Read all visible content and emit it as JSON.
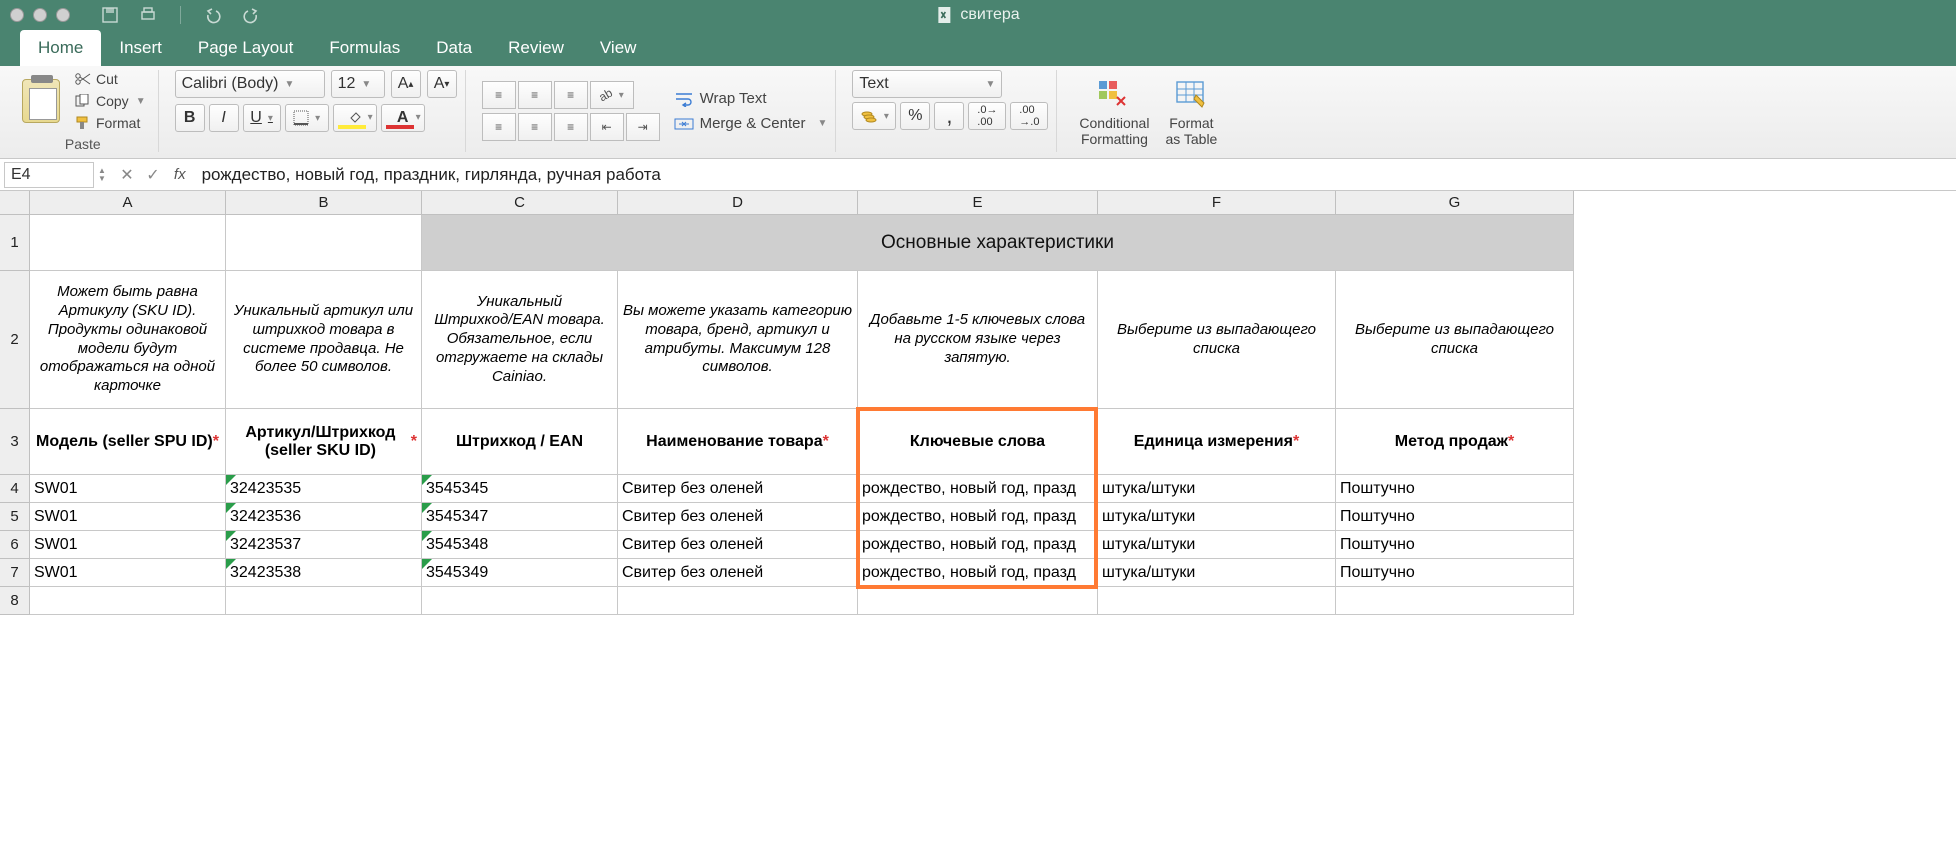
{
  "titlebar": {
    "doc_name": "свитера"
  },
  "tabs": {
    "home": "Home",
    "insert": "Insert",
    "page_layout": "Page Layout",
    "formulas": "Formulas",
    "data": "Data",
    "review": "Review",
    "view": "View"
  },
  "clipboard": {
    "paste": "Paste",
    "cut": "Cut",
    "copy": "Copy",
    "format": "Format"
  },
  "font": {
    "name": "Calibri (Body)",
    "size": "12",
    "bold": "B",
    "italic": "I",
    "underline": "U"
  },
  "align": {
    "wrap": "Wrap Text",
    "merge": "Merge & Center"
  },
  "number": {
    "format": "Text",
    "percent": "%",
    "comma": ",",
    "inc": ".00",
    "dec": ".0"
  },
  "cond": {
    "label1": "Conditional",
    "label2": "Formatting"
  },
  "fmt_table": {
    "label1": "Format",
    "label2": "as Table"
  },
  "formula_bar": {
    "cell_ref": "E4",
    "fx": "fx",
    "value": "рождество, новый год, праздник, гирлянда, ручная работа"
  },
  "columns": [
    "A",
    "B",
    "C",
    "D",
    "E",
    "F",
    "G"
  ],
  "row1_title": "Основные характеристики",
  "row2_desc": {
    "A": "Может быть равна Артикулу (SKU ID). Продукты одинаковой модели будут отображаться на одной карточке",
    "B": "Уникальный артикул или штрихкод товара в системе продавца. Не более 50 символов.",
    "C": "Уникальный Штрихкод/EAN товара. Обязательное, если отгружаете на склады Cainiao.",
    "D": "Вы можете указать категорию товара, бренд, артикул и атрибуты. Максимум 128 символов.",
    "E": "Добавьте 1-5 ключевых слова на русском языке через запятую.",
    "F": "Выберите из выпадающего списка",
    "G": "Выберите из выпадающего списка"
  },
  "row3_labels": {
    "A": "Модель (seller SPU ID)",
    "B": "Артикул/Штрихкод (seller SKU ID)",
    "C": "Штрихкод  / EAN",
    "D": "Наименование товара",
    "E": "Ключевые слова",
    "F": "Единица измерения",
    "G": "Метод продаж"
  },
  "row3_required": {
    "A": true,
    "B": true,
    "C": false,
    "D": true,
    "E": false,
    "F": true,
    "G": true
  },
  "data_rows": [
    {
      "n": "4",
      "A": "SW01",
      "B": "32423535",
      "C": "3545345",
      "D": "Свитер без оленей",
      "E": "рождество, новый год, празд",
      "F": "штука/штуки",
      "G": "Поштучно"
    },
    {
      "n": "5",
      "A": "SW01",
      "B": "32423536",
      "C": "3545347",
      "D": "Свитер без оленей",
      "E": "рождество, новый год, празд",
      "F": "штука/штуки",
      "G": "Поштучно"
    },
    {
      "n": "6",
      "A": "SW01",
      "B": "32423537",
      "C": "3545348",
      "D": "Свитер без оленей",
      "E": "рождество, новый год, празд",
      "F": "штука/штуки",
      "G": "Поштучно"
    },
    {
      "n": "7",
      "A": "SW01",
      "B": "32423538",
      "C": "3545349",
      "D": "Свитер без оленей",
      "E": "рождество, новый год, празд",
      "F": "штука/штуки",
      "G": "Поштучно"
    }
  ],
  "empty_rows": [
    "8"
  ]
}
